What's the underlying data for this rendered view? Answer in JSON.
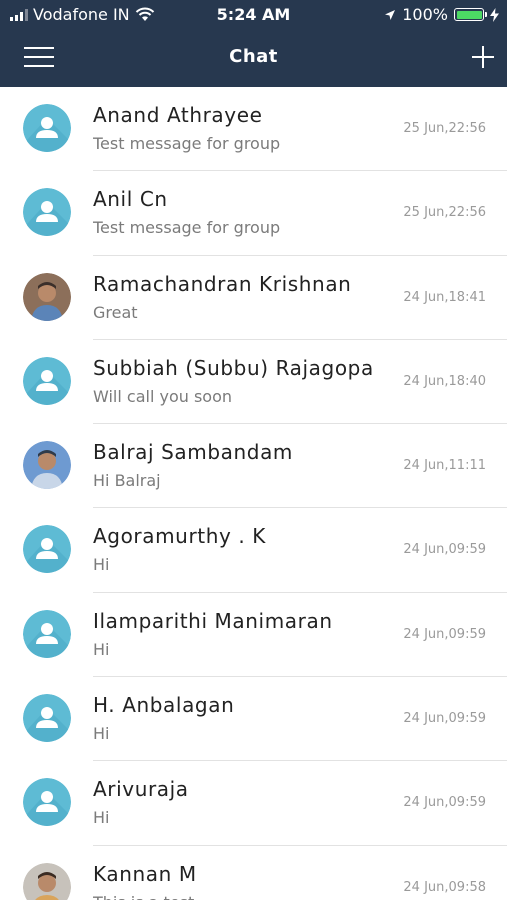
{
  "status_bar": {
    "carrier": "Vodafone IN",
    "time": "5:24 AM",
    "battery": "100%",
    "battery_level": 1.0
  },
  "header": {
    "title": "Chat",
    "menu_icon": "hamburger-menu-icon",
    "add_icon": "plus-icon"
  },
  "colors": {
    "header_bg": "#27384f",
    "avatar_default": "#5ebbd4",
    "battery_fill": "#4cd964"
  },
  "chats": [
    {
      "name": "Anand Athrayee",
      "message": "Test message for group",
      "time": "25 Jun,22:56",
      "avatar": "default-user-avatar"
    },
    {
      "name": "Anil Cn",
      "message": "Test message for group",
      "time": "25 Jun,22:56",
      "avatar": "default-user-avatar"
    },
    {
      "name": "Ramachandran Krishnan",
      "message": "Great",
      "time": "24 Jun,18:41",
      "avatar": "photo-avatar"
    },
    {
      "name": "Subbiah (Subbu) Rajagopa",
      "message": "Will call you soon",
      "time": "24 Jun,18:40",
      "avatar": "default-user-avatar"
    },
    {
      "name": "Balraj Sambandam",
      "message": "Hi Balraj",
      "time": "24 Jun,11:11",
      "avatar": "photo-avatar"
    },
    {
      "name": "Agoramurthy . K",
      "message": "Hi",
      "time": "24 Jun,09:59",
      "avatar": "default-user-avatar"
    },
    {
      "name": "Ilamparithi Manimaran",
      "message": "Hi",
      "time": "24 Jun,09:59",
      "avatar": "default-user-avatar"
    },
    {
      "name": "H. Anbalagan",
      "message": "Hi",
      "time": "24 Jun,09:59",
      "avatar": "default-user-avatar"
    },
    {
      "name": "Arivuraja",
      "message": "Hi",
      "time": "24 Jun,09:59",
      "avatar": "default-user-avatar"
    },
    {
      "name": "Kannan M",
      "message": "This is a test",
      "time": "24 Jun,09:58",
      "avatar": "photo-avatar"
    }
  ]
}
